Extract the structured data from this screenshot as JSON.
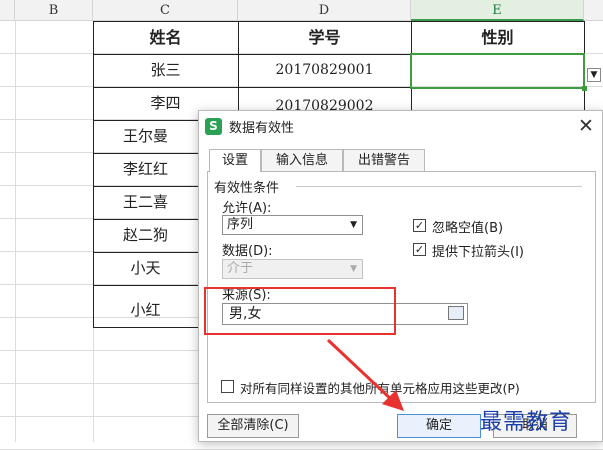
{
  "sheet": {
    "columns": [
      "B",
      "C",
      "D",
      "E"
    ],
    "selected_column": "E",
    "header": {
      "name": "姓名",
      "id": "学号",
      "gender": "性别"
    },
    "rows": [
      {
        "name": "张三",
        "id": "20170829001"
      },
      {
        "name": "李四",
        "id": "20170829002"
      },
      {
        "name": "王尔曼",
        "id": ""
      },
      {
        "name": "李红红",
        "id": ""
      },
      {
        "name": "王二喜",
        "id": ""
      },
      {
        "name": "赵二狗",
        "id": ""
      },
      {
        "name": "小天",
        "id": ""
      },
      {
        "name": "小红",
        "id": ""
      }
    ],
    "dropdown_arrow": "▼"
  },
  "dialog": {
    "icon_letter": "S",
    "title": "数据有效性",
    "close_glyph": "✕",
    "tabs": [
      "设置",
      "输入信息",
      "出错警告"
    ],
    "active_tab": 0,
    "group_title": "有效性条件",
    "allow_label": "允许(A):",
    "allow_value": "序列",
    "data_label": "数据(D):",
    "data_value": "介于",
    "ignore_blank_label": "忽略空值(B)",
    "ignore_blank_checked": true,
    "dropdown_label": "提供下拉箭头(I)",
    "dropdown_checked": true,
    "source_label": "来源(S):",
    "source_value": "男,女",
    "apply_all_label": "对所有同样设置的其他所有单元格应用这些更改(P)",
    "apply_all_checked": false,
    "clear_button": "全部清除(C)",
    "ok_button": "确定",
    "cancel_button": "取消",
    "check_glyph": "✓",
    "select_arrow": "▼"
  },
  "watermark": {
    "text": "最需教育"
  },
  "colors": {
    "accent_green": "#3f9b3f",
    "highlight_red": "#e8322f",
    "app_icon": "#2aa154"
  }
}
